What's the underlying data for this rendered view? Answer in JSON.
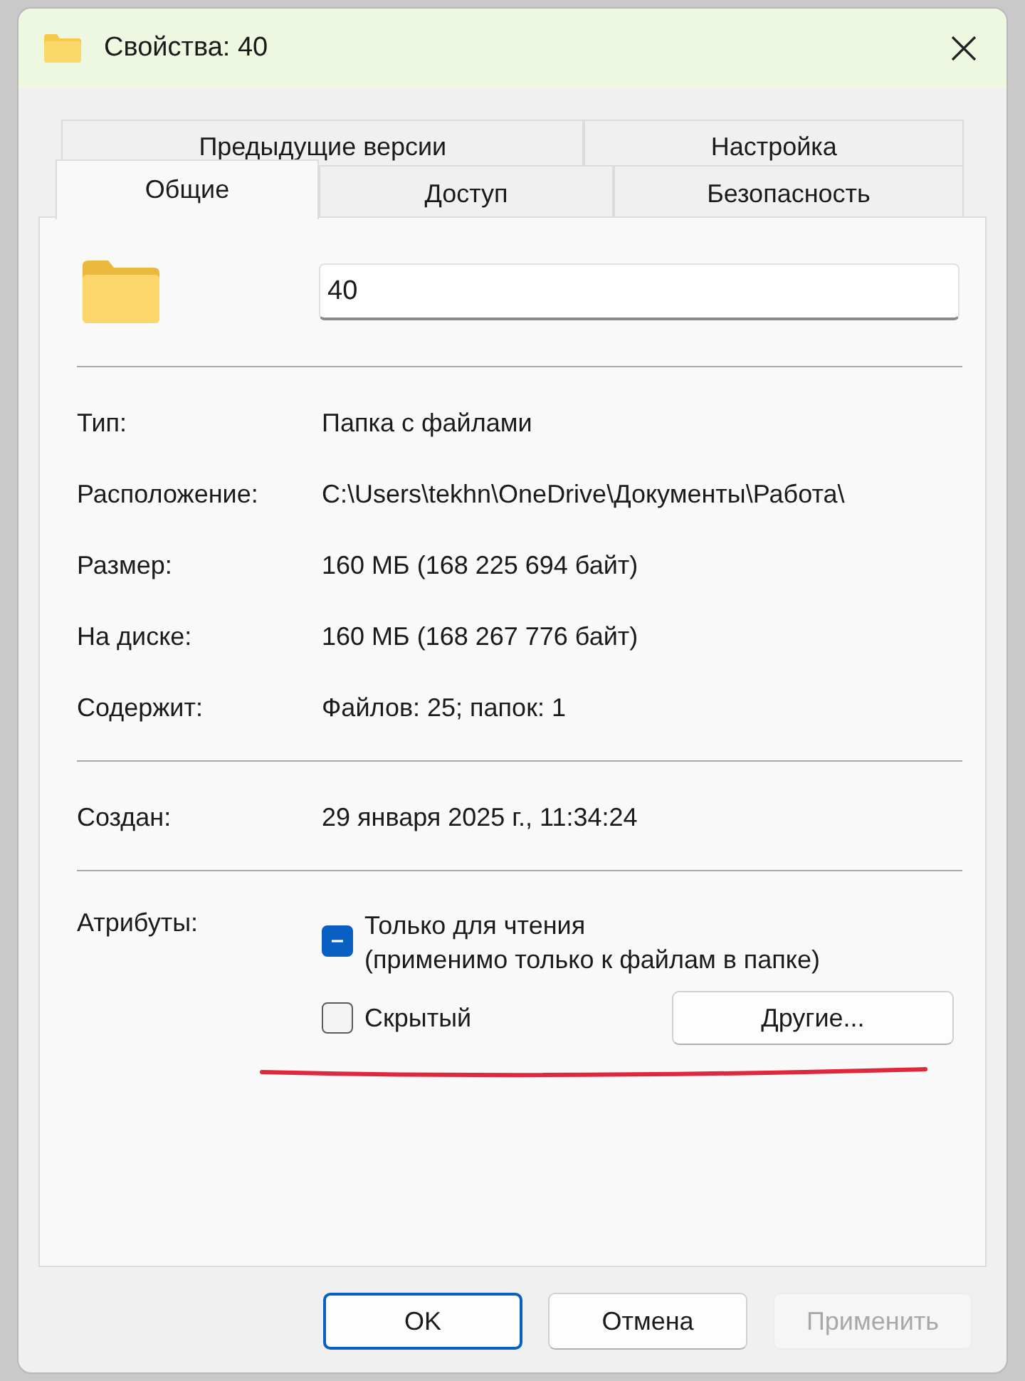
{
  "window": {
    "title": "Свойства: 40"
  },
  "tabs": [
    [
      {
        "label": "Предыдущие версии",
        "selected": false
      },
      {
        "label": "Настройка",
        "selected": false
      }
    ],
    [
      {
        "label": "Общие",
        "selected": true
      },
      {
        "label": "Доступ",
        "selected": false
      },
      {
        "label": "Безопасность",
        "selected": false
      }
    ]
  ],
  "name_field": {
    "value": "40"
  },
  "info_groups": [
    [
      {
        "label": "Тип:",
        "value": "Папка с файлами"
      },
      {
        "label": "Расположение:",
        "value": "C:\\Users\\tekhn\\OneDrive\\Документы\\Работа\\"
      },
      {
        "label": "Размер:",
        "value": "160 МБ (168 225 694 байт)"
      },
      {
        "label": "На диске:",
        "value": "160 МБ (168 267 776 байт)"
      },
      {
        "label": "Содержит:",
        "value": "Файлов: 25; папок: 1"
      }
    ],
    [
      {
        "label": "Создан:",
        "value": "29 января 2025 г., 11:34:24"
      }
    ]
  ],
  "attributes": {
    "label": "Атрибуты:",
    "checkboxes": [
      {
        "label": "Только для чтения",
        "note": "(применимо только к файлам в папке)",
        "checked": true,
        "indeterminate": true
      },
      {
        "label": "Скрытый",
        "checked": false,
        "indeterminate": false
      }
    ],
    "advanced_button": "Другие..."
  },
  "buttons": [
    {
      "label": "OK",
      "default": true,
      "disabled": false
    },
    {
      "label": "Отмена",
      "default": false,
      "disabled": false
    },
    {
      "label": "Применить",
      "default": false,
      "disabled": true
    }
  ]
}
